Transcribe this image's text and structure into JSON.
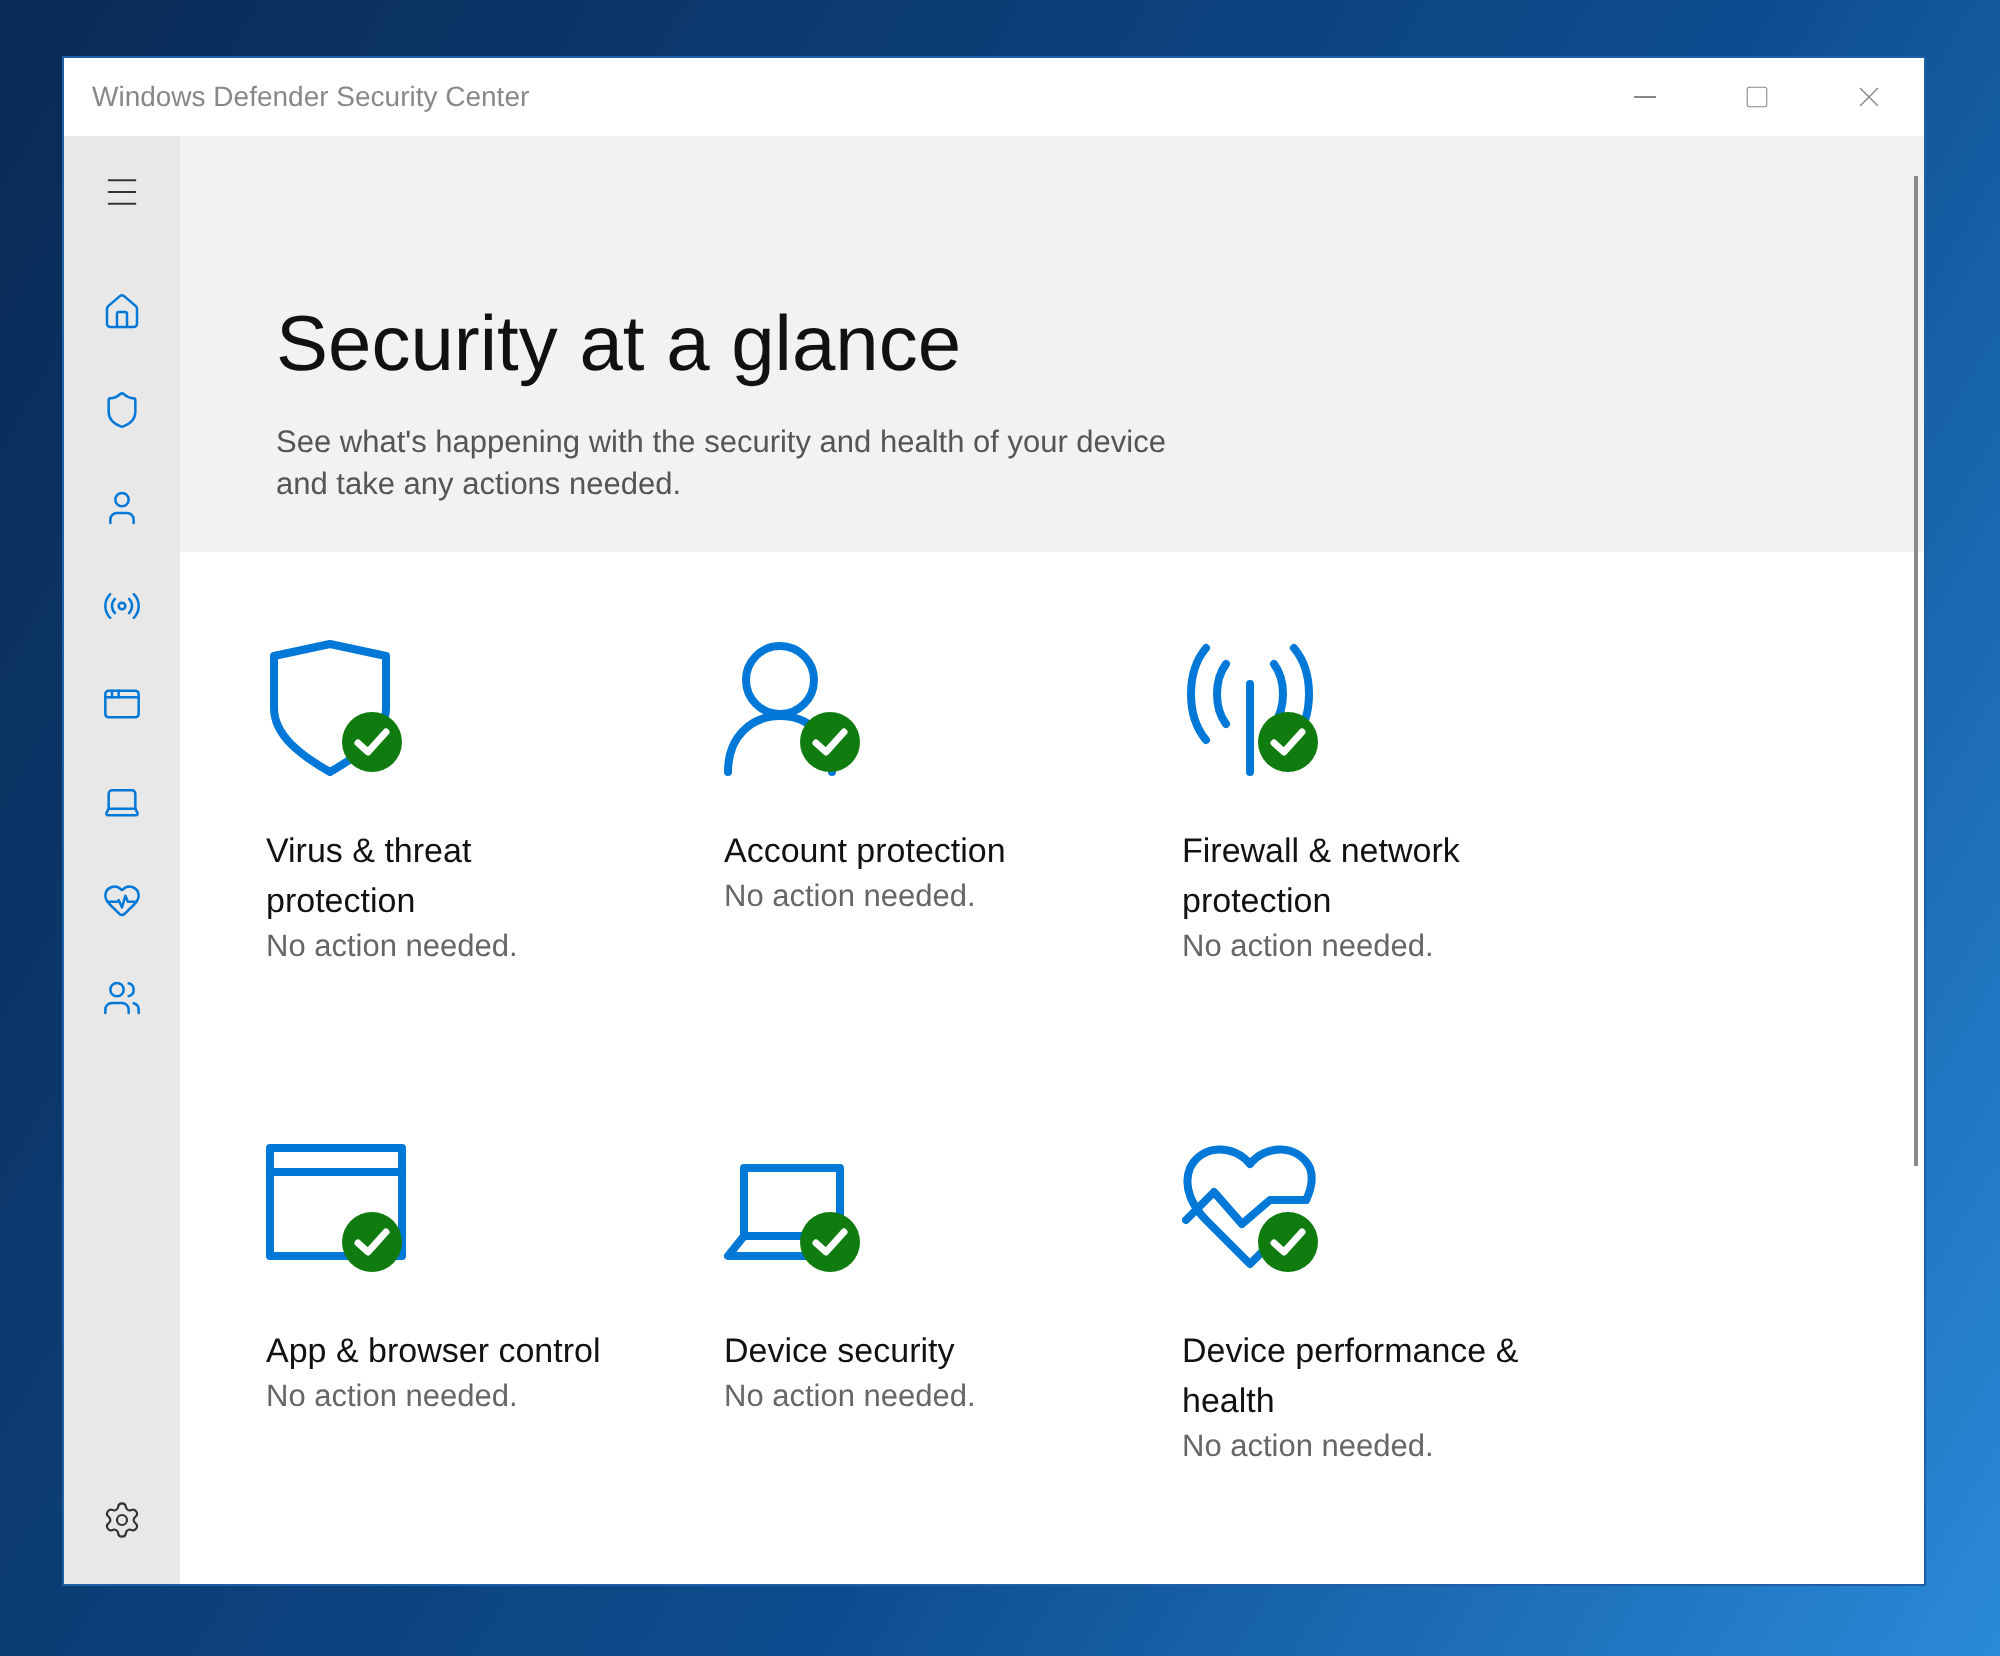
{
  "window": {
    "title": "Windows Defender Security Center"
  },
  "sidebar": {
    "items": [
      {
        "kind": "home"
      },
      {
        "kind": "shield"
      },
      {
        "kind": "person"
      },
      {
        "kind": "antenna"
      },
      {
        "kind": "browser"
      },
      {
        "kind": "laptop"
      },
      {
        "kind": "heart"
      },
      {
        "kind": "family"
      }
    ]
  },
  "header": {
    "title": "Security at a glance",
    "subtitle": "See what's happening with the security and health of your device and take any actions needed."
  },
  "tiles": [
    {
      "kind": "shield",
      "ok": true,
      "title": "Virus & threat protection",
      "detail": "No action needed."
    },
    {
      "kind": "person",
      "ok": true,
      "title": "Account protection",
      "detail": "No action needed."
    },
    {
      "kind": "antenna",
      "ok": true,
      "title": "Firewall & network protection",
      "detail": "No action needed."
    },
    {
      "kind": "browser",
      "ok": true,
      "title": "App & browser control",
      "detail": "No action needed."
    },
    {
      "kind": "laptop",
      "ok": true,
      "title": "Device security",
      "detail": "No action needed."
    },
    {
      "kind": "heart",
      "ok": true,
      "title": "Device performance & health",
      "detail": "No action needed."
    }
  ]
}
